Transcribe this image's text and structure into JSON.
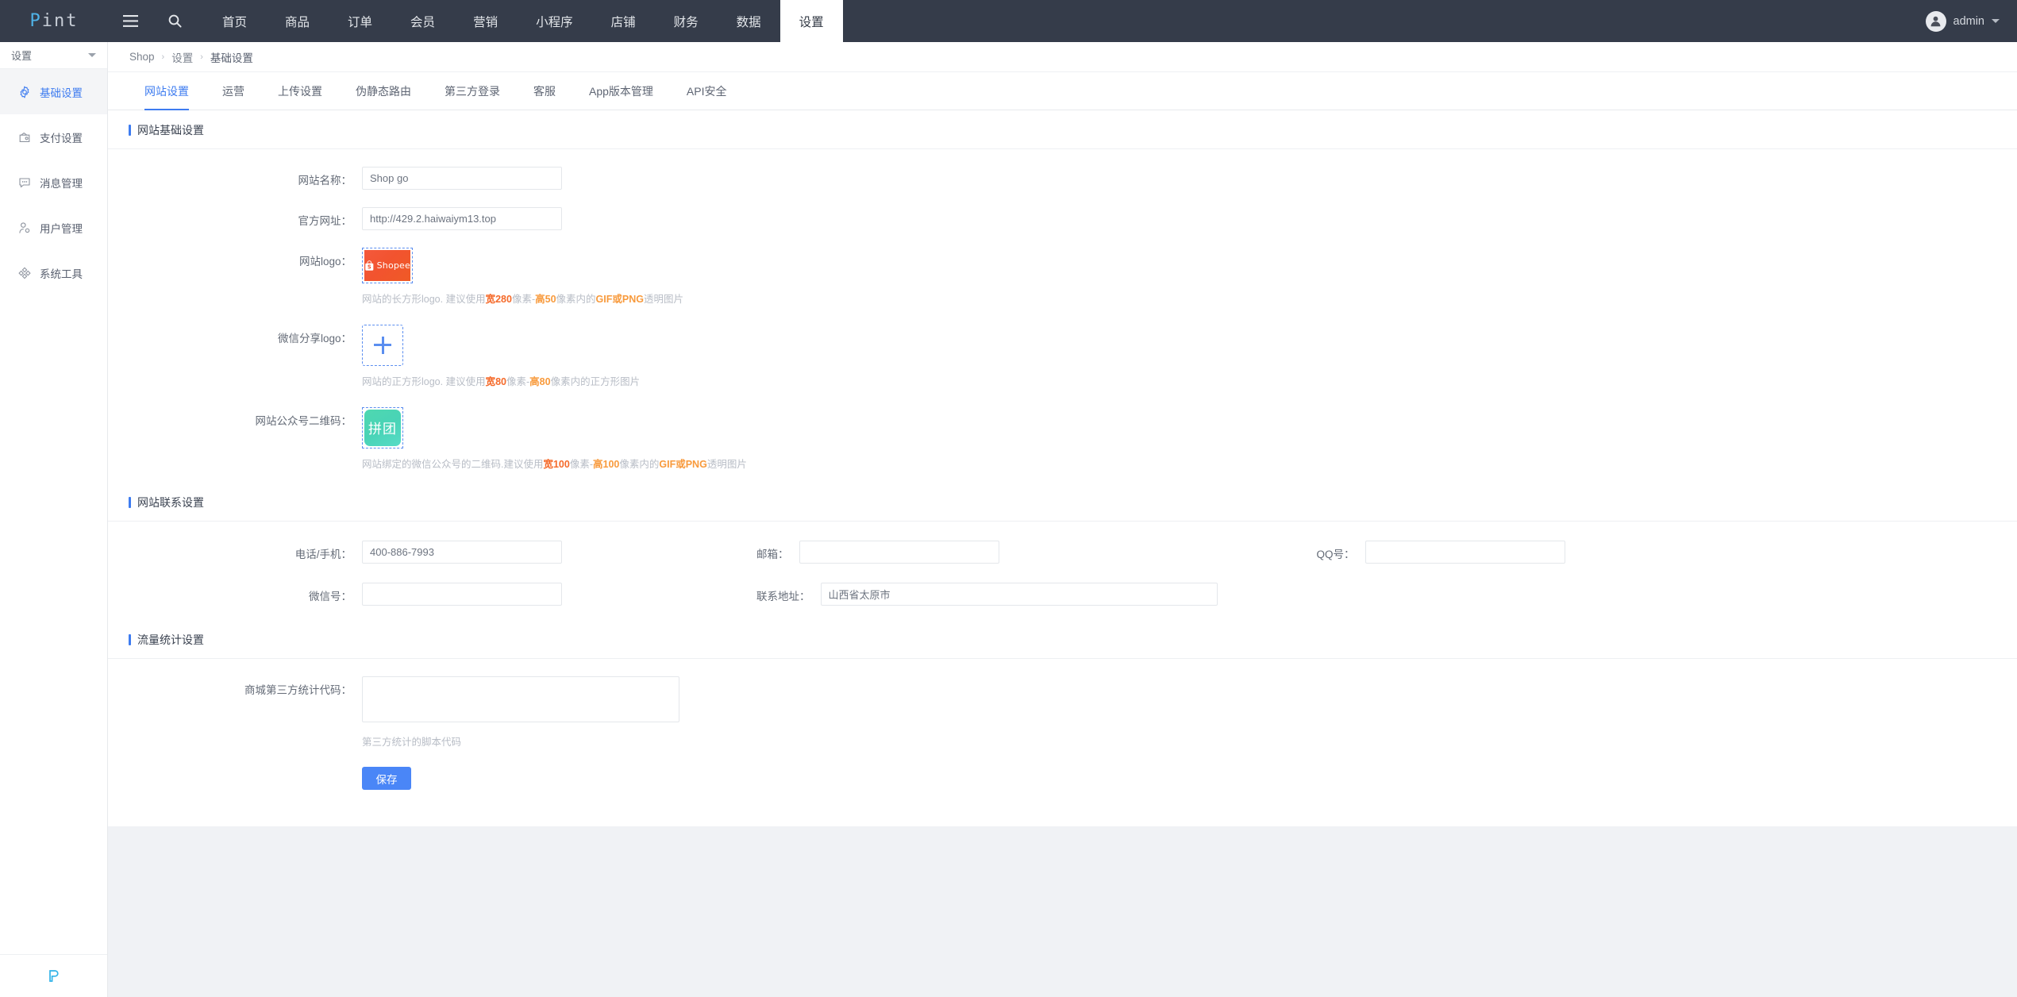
{
  "topnav": {
    "brand": "Pint",
    "brand_prefix": "P",
    "brand_suffix": "int",
    "menu_icon": "hamburger-icon",
    "search_icon": "search-icon",
    "items": [
      {
        "label": "首页",
        "active": false
      },
      {
        "label": "商品",
        "active": false
      },
      {
        "label": "订单",
        "active": false
      },
      {
        "label": "会员",
        "active": false
      },
      {
        "label": "营销",
        "active": false
      },
      {
        "label": "小程序",
        "active": false
      },
      {
        "label": "店铺",
        "active": false
      },
      {
        "label": "财务",
        "active": false
      },
      {
        "label": "数据",
        "active": false
      },
      {
        "label": "设置",
        "active": true
      }
    ],
    "user": {
      "name": "admin",
      "avatar_icon": "user-avatar-icon",
      "caret_icon": "chevron-down-icon"
    }
  },
  "sidebar": {
    "header": "设置",
    "collapse_icon": "caret-down-icon",
    "footer_logo": "P",
    "items": [
      {
        "label": "基础设置",
        "icon": "gear-icon",
        "active": true
      },
      {
        "label": "支付设置",
        "icon": "wallet-icon",
        "active": false
      },
      {
        "label": "消息管理",
        "icon": "chat-bubble-icon",
        "active": false
      },
      {
        "label": "用户管理",
        "icon": "user-settings-icon",
        "active": false
      },
      {
        "label": "系统工具",
        "icon": "tools-icon",
        "active": false
      }
    ]
  },
  "breadcrumb": {
    "items": [
      "Shop",
      "设置",
      "基础设置"
    ],
    "separator": "›"
  },
  "tabs": [
    {
      "label": "网站设置",
      "active": true
    },
    {
      "label": "运营",
      "active": false
    },
    {
      "label": "上传设置",
      "active": false
    },
    {
      "label": "伪静态路由",
      "active": false
    },
    {
      "label": "第三方登录",
      "active": false
    },
    {
      "label": "客服",
      "active": false
    },
    {
      "label": "App版本管理",
      "active": false
    },
    {
      "label": "API安全",
      "active": false
    }
  ],
  "sections": {
    "basic": {
      "title": "网站基础设置",
      "site_name": {
        "label": "网站名称：",
        "value": "Shop go",
        "placeholder": ""
      },
      "site_url": {
        "label": "官方网址：",
        "value": "http://429.2.haiwaiym13.top",
        "placeholder": ""
      },
      "site_logo": {
        "label": "网站logo：",
        "image_alt": "Shopee",
        "image_text": "Shopee",
        "hint_pre": "网站的长方形logo. 建议使用",
        "hint_w": "宽280",
        "hint_mid1": "像素-",
        "hint_h": "高50",
        "hint_mid2": "像素内的",
        "hint_fmt": "GIF或PNG",
        "hint_post": "透明图片"
      },
      "wechat_logo": {
        "label": "微信分享logo：",
        "upload_icon": "plus-icon",
        "hint_pre": "网站的正方形logo. 建议使用",
        "hint_w": "宽80",
        "hint_mid1": "像素-",
        "hint_h": "高80",
        "hint_post": "像素内的正方形图片"
      },
      "qrcode": {
        "label": "网站公众号二维码：",
        "image_text": "拼团",
        "hint_pre": "网站绑定的微信公众号的二维码.建议使用",
        "hint_w": "宽100",
        "hint_mid1": "像素-",
        "hint_h": "高100",
        "hint_mid2": "像素内的",
        "hint_fmt": "GIF或PNG",
        "hint_post": "透明图片"
      }
    },
    "contact": {
      "title": "网站联系设置",
      "phone": {
        "label": "电话/手机：",
        "value": "400-886-7993",
        "placeholder": ""
      },
      "email": {
        "label": "邮箱：",
        "value": "",
        "placeholder": ""
      },
      "qq": {
        "label": "QQ号：",
        "value": "",
        "placeholder": ""
      },
      "wechat": {
        "label": "微信号：",
        "value": "",
        "placeholder": ""
      },
      "address": {
        "label": "联系地址：",
        "value": "山西省太原市",
        "placeholder": ""
      }
    },
    "stats": {
      "title": "流量统计设置",
      "code": {
        "label": "商城第三方统计代码：",
        "value": "",
        "placeholder": ""
      },
      "hint": "第三方统计的脚本代码",
      "save_label": "保存"
    }
  },
  "colors": {
    "nav_bg": "#353c4a",
    "accent": "#3e7cf0",
    "save_btn": "#4a86f7",
    "hint_orange": "#f56a2a",
    "logo_orange": "#f2532f",
    "qr_teal": "#4fd8b0"
  }
}
